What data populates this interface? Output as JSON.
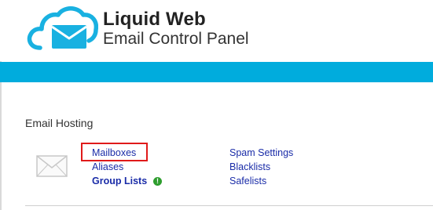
{
  "header": {
    "brand": "Liquid Web",
    "subtitle": "Email Control Panel"
  },
  "section": {
    "title": "Email Hosting"
  },
  "links_left": {
    "mailboxes": "Mailboxes",
    "aliases": "Aliases",
    "group_lists": "Group Lists"
  },
  "links_right": {
    "spam_settings": "Spam Settings",
    "blacklists": "Blacklists",
    "safelists": "Safelists"
  },
  "badge": {
    "info_symbol": "!"
  },
  "colors": {
    "banner": "#00acdd",
    "link": "#1a2ca8",
    "highlight": "#e01a1a",
    "info": "#2e9d2e"
  },
  "icons": [
    "cloud-email-logo-icon",
    "envelope-icon",
    "info-icon"
  ]
}
